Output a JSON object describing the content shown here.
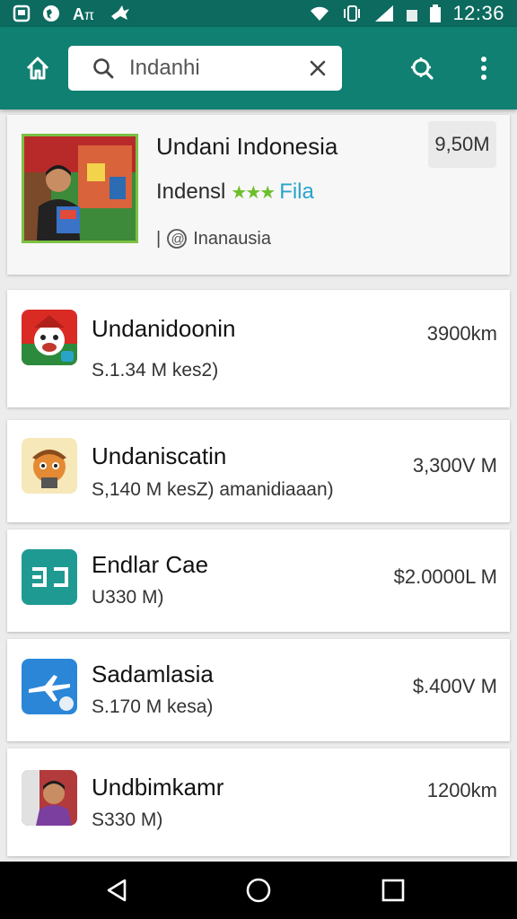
{
  "status_bar": {
    "time": "12:36",
    "left_icons": [
      "notification-icon",
      "globe-icon",
      "keyboard-icon",
      "bird-icon"
    ],
    "right_icons": [
      "wifi-icon",
      "vibrate-icon",
      "signal-icon",
      "battery-icon"
    ]
  },
  "search": {
    "query": "Indanhi",
    "placeholder": ""
  },
  "colors": {
    "appbar": "#0f8071",
    "statusbar": "#0c6a5f",
    "accent_green": "#6cbf2b",
    "accent_blue": "#2aa3c9"
  },
  "featured": {
    "title": "Undani Indonesia",
    "subtitle": "Indensl",
    "stars": "★★★",
    "tag": "Fila",
    "meta": "Inanausia",
    "price": "9,50M"
  },
  "results": [
    {
      "title": "Undanidoonin",
      "subtitle": "S.1.34 M kes2)",
      "price": "3900km",
      "icon": "santa-face-icon"
    },
    {
      "title": "Undaniscatin",
      "subtitle": "S,140 M kesZ) amanidiaaan)",
      "price": "3,300V M",
      "icon": "cartoon-character-icon"
    },
    {
      "title": "Endlar Cae",
      "subtitle": "U330 M)",
      "price": "$2.0000L M",
      "icon": "teal-app-icon"
    },
    {
      "title": "Sadamlasia",
      "subtitle": "S.170 M kesa)",
      "price": "$.400V M",
      "icon": "plane-icon"
    },
    {
      "title": "Undbimkamr",
      "subtitle": "S330 M)",
      "price": "1200km",
      "icon": "person-photo-icon"
    }
  ],
  "nav": [
    "back-icon",
    "home-icon",
    "recents-icon"
  ]
}
